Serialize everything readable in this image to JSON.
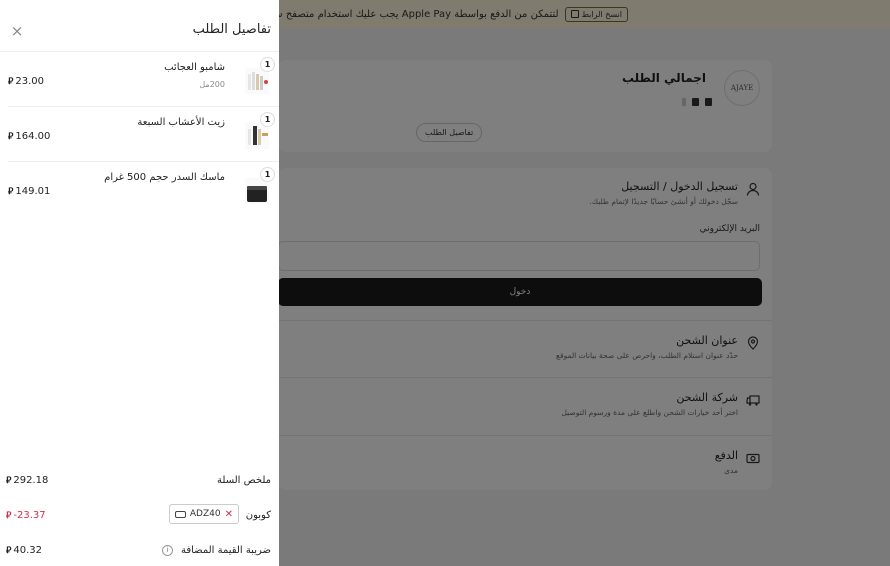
{
  "banner": {
    "text": "لتتمكن من الدفع بواسطة Apple Pay يجب عليك استخدام متصفح سفاري",
    "copy_button": "انسخ الرابط"
  },
  "order_summary": {
    "title": "اجمالي الطلب",
    "logo_text": "AJAYE",
    "details_button": "تفاصيل الطلب"
  },
  "checkout": {
    "login": {
      "title": "تسجيل الدخول / التسجيل",
      "subtitle": "سجّل دخولك أو أنشئ حسابًا جديدًا لإتمام طلبك.",
      "email_label": "البريد الإلكتروني",
      "button": "دخول"
    },
    "shipping_address": {
      "title": "عنوان الشحن",
      "subtitle": "حدّد عنوان استلام الطلب، واحرص على صحة بيانات الموقع"
    },
    "shipping_company": {
      "title": "شركة الشحن",
      "subtitle": "اختر أحد خيارات الشحن واطلع على مدة ورسوم التوصيل"
    },
    "payment": {
      "title": "الدفع",
      "subtitle": "مدى"
    }
  },
  "drawer": {
    "title": "تفاصيل الطلب",
    "currency_symbol": "⃁",
    "items": [
      {
        "name": "شامبو العجائب",
        "variant": "200مل",
        "qty": "1",
        "price": "23.00"
      },
      {
        "name": "زيت الأعشاب السبعة",
        "variant": "",
        "qty": "1",
        "price": "164.00"
      },
      {
        "name": "ماسك السدر حجم 500 غرام",
        "variant": "",
        "qty": "1",
        "price": "149.01"
      }
    ],
    "summary": {
      "cart_label": "ملخص السلة",
      "cart_value": "292.18",
      "coupon_label": "كوبون",
      "coupon_code": "ADZ40",
      "coupon_value": "-23.37",
      "vat_label": "ضريبة القيمة المضافة",
      "vat_value": "40.32"
    }
  },
  "colors": {
    "accent_dark": "#1b1b1b",
    "negative": "#d0324a",
    "banner_bg": "#fff6dd"
  }
}
